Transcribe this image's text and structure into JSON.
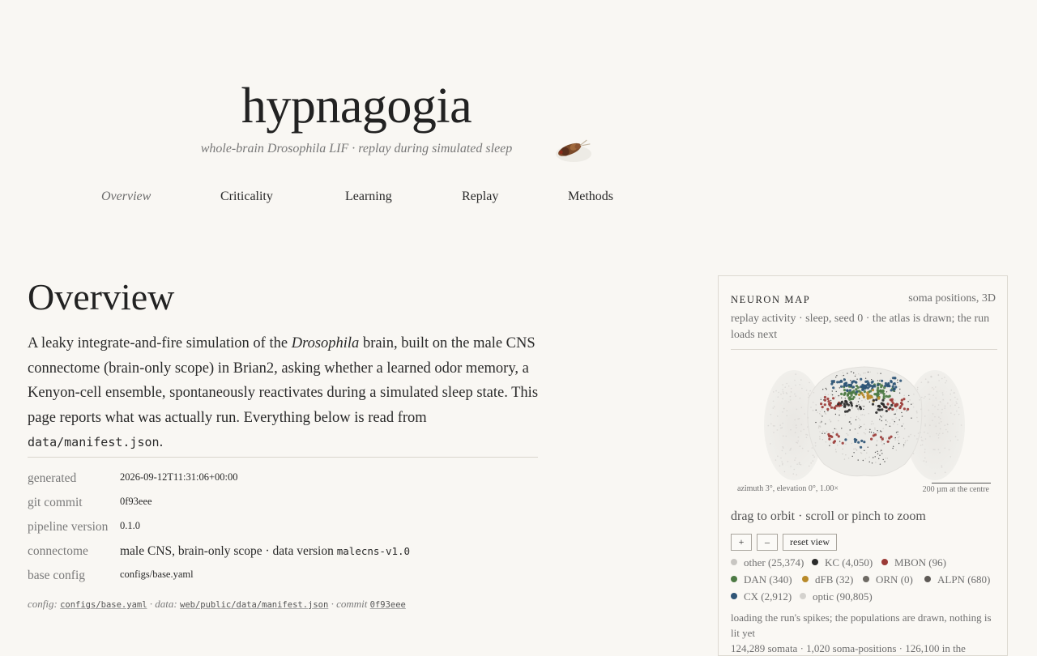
{
  "header": {
    "title": "hypnagogia",
    "subtitle": "whole-brain Drosophila LIF · replay during simulated sleep"
  },
  "nav": [
    {
      "label": "Overview",
      "active": true
    },
    {
      "label": "Criticality",
      "active": false
    },
    {
      "label": "Learning",
      "active": false
    },
    {
      "label": "Replay",
      "active": false
    },
    {
      "label": "Methods",
      "active": false
    }
  ],
  "main": {
    "heading": "Overview",
    "intro": {
      "p1": "A leaky integrate-and-fire simulation of the ",
      "emph": "Drosophila",
      "p2": " brain, built on the male CNS connectome (brain-only scope) in Brian2, asking whether a learned odor memory, a Kenyon-cell ensemble, spontaneously reactivates during a simulated sleep state. This page reports what was actually run. Everything below is read from ",
      "code": "data/manifest.json",
      "p3": "."
    },
    "meta": {
      "generated_label": "generated",
      "generated_value": "2026-09-12T11:31:06+00:00",
      "commit_label": "git commit",
      "commit_value": "0f93eee",
      "pipeline_label": "pipeline version",
      "pipeline_value": "0.1.0",
      "connectome_label": "connectome",
      "connectome_text": "male CNS, brain-only scope · data version ",
      "connectome_code": "malecns-v1.0",
      "config_label": "base config",
      "config_value": "configs/base.yaml"
    },
    "footer": {
      "config_label": "config:",
      "config_link": "configs/base.yaml",
      "sep1": " · ",
      "data_label": "data:",
      "data_link": "web/public/data/manifest.json",
      "sep2": " · ",
      "commit_label": "commit",
      "commit_link": "0f93eee"
    }
  },
  "neuron_map": {
    "title": "NEURON MAP",
    "tag": "soma positions, 3D",
    "status": "replay activity · sleep, seed 0 · the atlas is drawn; the run loads next",
    "camera": "azimuth 3°, elevation 0°, 1.00×",
    "scale": "200 µm at the centre",
    "hint": "drag to orbit · scroll or pinch to zoom",
    "zoom_in": "+",
    "zoom_out": "–",
    "reset": "reset view",
    "legend": [
      {
        "label": "other (25,374)",
        "color": "#c8c6c2"
      },
      {
        "label": "KC (4,050)",
        "color": "#2b2b2b"
      },
      {
        "label": "MBON (96)",
        "color": "#9b3a36"
      },
      {
        "label": "DAN (340)",
        "color": "#4d7a45"
      },
      {
        "label": "dFB (32)",
        "color": "#b88a2a"
      },
      {
        "label": "ORN (0)",
        "color": "#6e6a64"
      },
      {
        "label": "ALPN (680)",
        "color": "#5e5a56"
      },
      {
        "label": "CX (2,912)",
        "color": "#2f5577"
      },
      {
        "label": "optic (90,805)",
        "color": "#d4d2ce"
      }
    ],
    "loading": "loading the run's spikes; the populations are drawn, nothing is lit yet",
    "stats": "124,289 somata · 1,020 soma-positions · 126,100 in the"
  }
}
